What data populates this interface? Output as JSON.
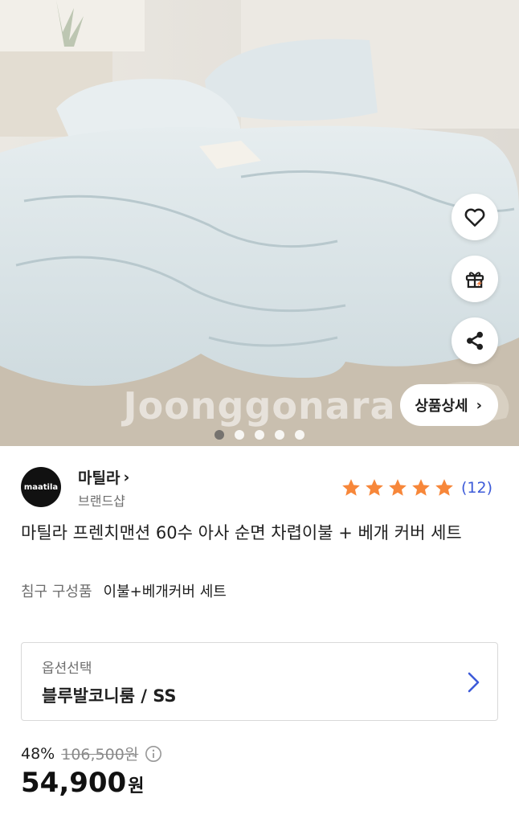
{
  "hero": {
    "watermark": "Joonggonara",
    "detail_button_label": "상품상세",
    "detail_button_chevron": "›",
    "slide_count": 5,
    "active_slide": 1,
    "icons": [
      "heart-icon",
      "gift-icon",
      "share-icon"
    ]
  },
  "seller": {
    "logo_text": "maatila",
    "name": "마틸라",
    "chevron": "›",
    "type": "브랜드샵",
    "rating_stars": 5,
    "review_count": "(12)"
  },
  "product": {
    "title": "마틸라 프렌치맨션 60수 아사 순면 차렵이불 + 베개 커버 세트",
    "spec_key": "침구 구성품",
    "spec_value": "이불+베개커버 세트"
  },
  "option": {
    "label": "옵션선택",
    "value": "블루발코니룸 / SS"
  },
  "price": {
    "discount": "48%",
    "original": "106,500원",
    "final": "54,900",
    "currency": "원"
  },
  "colors": {
    "star": "#f7873a",
    "review_link": "#3d5bd9",
    "chevron": "#3d5bd9"
  }
}
